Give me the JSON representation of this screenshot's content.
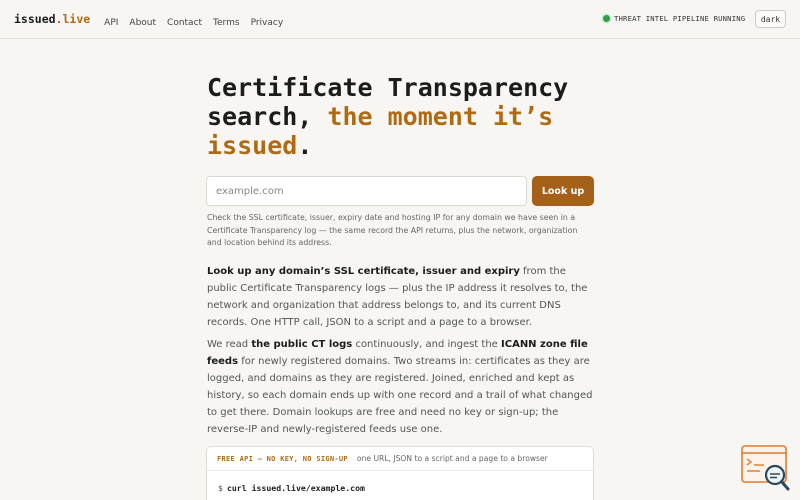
{
  "header": {
    "brand_name": "issued",
    "brand_tld": ".live",
    "nav": [
      {
        "label": "API"
      },
      {
        "label": "About"
      },
      {
        "label": "Contact"
      },
      {
        "label": "Terms"
      },
      {
        "label": "Privacy"
      }
    ],
    "status_text": "THREAT INTEL PIPELINE RUNNING",
    "status_color": "#2f9e44",
    "theme_toggle_label": "dark"
  },
  "hero": {
    "title_part1": "Certificate Transparency search,",
    "title_accent": "the moment it’s issued",
    "title_end": ".",
    "accent_color": "#b06a12"
  },
  "search": {
    "placeholder": "example.com",
    "button_label": "Look up",
    "hint": "Check the SSL certificate, issuer, expiry date and hosting IP for any domain we have seen in a Certificate Transparency log — the same record the API returns, plus the network, organization and location behind its address."
  },
  "intro": {
    "p1_bold": "Look up any domain’s SSL certificate, issuer and expiry",
    "p1_rest": " from the public Certificate Transparency logs — plus the IP address it resolves to, the network and organization that address belongs to, and its current DNS records. One HTTP call, JSON to a script and a page to a browser.",
    "p2_a": "We read ",
    "p2_bold1": "the public CT logs",
    "p2_b": " continuously, and ingest the ",
    "p2_bold2": "ICANN zone file feeds",
    "p2_c": " for newly registered domains. Two streams in: certificates as they are logged, and domains as they are registered. Joined, enriched and kept as history, so each domain ends up with one record and a trail of what changed to get there. Domain lookups are free and need no key or sign-up; the reverse-IP and newly-registered feeds use one."
  },
  "api_card": {
    "tag": "FREE API — NO KEY, NO SIGN-UP",
    "subtitle": "one URL, JSON to a script and a page to a browser",
    "prompt": "$",
    "command": "curl issued.live/example.com"
  },
  "corner_widget": {
    "icon": "log-search-icon",
    "color": "#e07a2e"
  }
}
